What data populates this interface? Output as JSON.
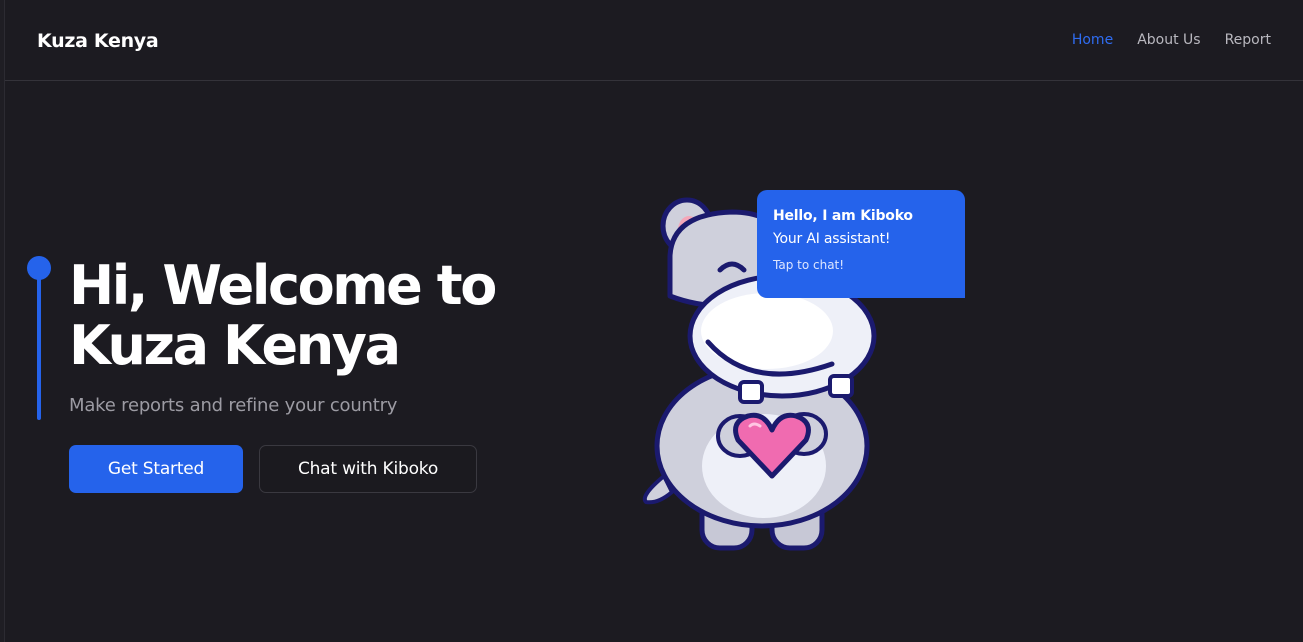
{
  "header": {
    "brand": "Kuza Kenya",
    "nav": [
      {
        "label": "Home",
        "active": true
      },
      {
        "label": "About Us",
        "active": false
      },
      {
        "label": "Report",
        "active": false
      }
    ]
  },
  "hero": {
    "title_line1": "Hi, Welcome to",
    "title_line2": "Kuza Kenya",
    "subtitle": "Make reports and refine your country",
    "primary_button": "Get Started",
    "secondary_button": "Chat with Kiboko"
  },
  "chat_bubble": {
    "title": "Hello, I am Kiboko",
    "subtitle": "Your AI assistant!",
    "cta": "Tap to chat!"
  },
  "mascot": {
    "icon": "hippo-mascot-icon"
  },
  "colors": {
    "background": "#1c1b21",
    "accent": "#2563eb",
    "nav_active": "#2f6cf0",
    "heart": "#f06bb0"
  }
}
